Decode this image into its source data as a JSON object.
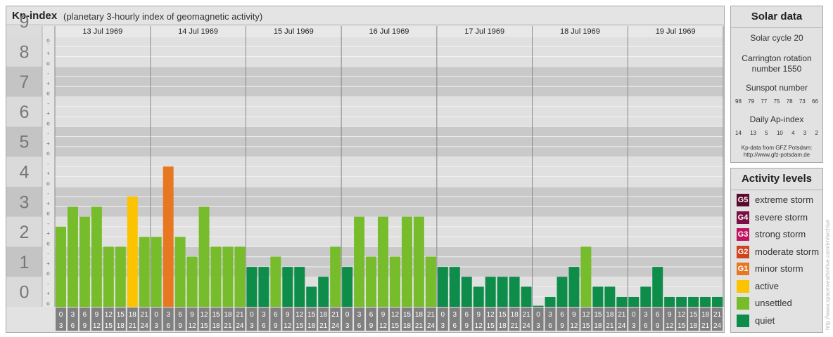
{
  "header": {
    "title": "Kp-index",
    "subtitle": "(planetary 3-hourly index of geomagnetic activity)"
  },
  "chart_data": {
    "type": "bar",
    "title": "Kp-index",
    "subtitle": "(planetary 3-hourly index of geomagnetic activity)",
    "ylim": [
      0,
      9
    ],
    "y_ticks": [
      "0",
      "1",
      "2",
      "3",
      "4",
      "5",
      "6",
      "7",
      "8",
      "9"
    ],
    "minor_ticks": [
      "-",
      "o",
      "+"
    ],
    "days": [
      "13 Jul 1969",
      "14 Jul 1969",
      "15 Jul 1969",
      "16 Jul 1969",
      "17 Jul 1969",
      "18 Jul 1969",
      "19 Jul 1969"
    ],
    "hour_start": [
      "0",
      "3",
      "6",
      "9",
      "12",
      "15",
      "18",
      "21"
    ],
    "hour_end": [
      "3",
      "6",
      "9",
      "12",
      "15",
      "18",
      "21",
      "24"
    ],
    "values": [
      [
        2.67,
        3.33,
        3.0,
        3.33,
        2.0,
        2.0,
        3.67,
        2.33
      ],
      [
        2.33,
        4.67,
        2.33,
        1.67,
        3.33,
        2.0,
        2.0,
        2.0
      ],
      [
        1.33,
        1.33,
        1.67,
        1.33,
        1.33,
        0.67,
        1.0,
        2.0
      ],
      [
        1.33,
        3.0,
        1.67,
        3.0,
        1.67,
        3.0,
        3.0,
        1.67
      ],
      [
        1.33,
        1.33,
        1.0,
        0.67,
        1.0,
        1.0,
        1.0,
        0.67
      ],
      [
        0.0,
        0.33,
        1.0,
        1.33,
        2.0,
        0.67,
        0.67,
        0.33
      ],
      [
        0.33,
        0.67,
        1.33,
        0.33,
        0.33,
        0.33,
        0.33,
        0.33
      ]
    ],
    "colors": {
      "quiet": "#0e8c4a",
      "unsettled": "#77bc2a",
      "active": "#fbc300",
      "G1": "#e87722"
    }
  },
  "solar": {
    "title": "Solar data",
    "cycle": "Solar cycle 20",
    "carrington_line1": "Carrington rotation",
    "carrington_line2": "number 1550",
    "sunspot_label": "Sunspot number",
    "sunspot_values": [
      "98",
      "79",
      "77",
      "75",
      "78",
      "73",
      "66"
    ],
    "ap_label": "Daily Ap-index",
    "ap_values": [
      "14",
      "13",
      "5",
      "10",
      "4",
      "3",
      "2"
    ],
    "source_line1": "Kp-data from GFZ Potsdam:",
    "source_line2": "http://www.gfz-potsdam.de"
  },
  "activity": {
    "title": "Activity levels",
    "levels": [
      {
        "code": "G5",
        "label": "extreme storm",
        "color": "#5a0a2a"
      },
      {
        "code": "G4",
        "label": "severe storm",
        "color": "#7a0f45"
      },
      {
        "code": "G3",
        "label": "strong storm",
        "color": "#c0145e"
      },
      {
        "code": "G2",
        "label": "moderate storm",
        "color": "#d2421e"
      },
      {
        "code": "G1",
        "label": "minor storm",
        "color": "#e87722"
      },
      {
        "code": "",
        "label": "active",
        "color": "#fbc300"
      },
      {
        "code": "",
        "label": "unsettled",
        "color": "#77bc2a"
      },
      {
        "code": "",
        "label": "quiet",
        "color": "#0e8c4a"
      }
    ]
  },
  "watermark": "http://www.spaceweatherlive.com/en/archive"
}
